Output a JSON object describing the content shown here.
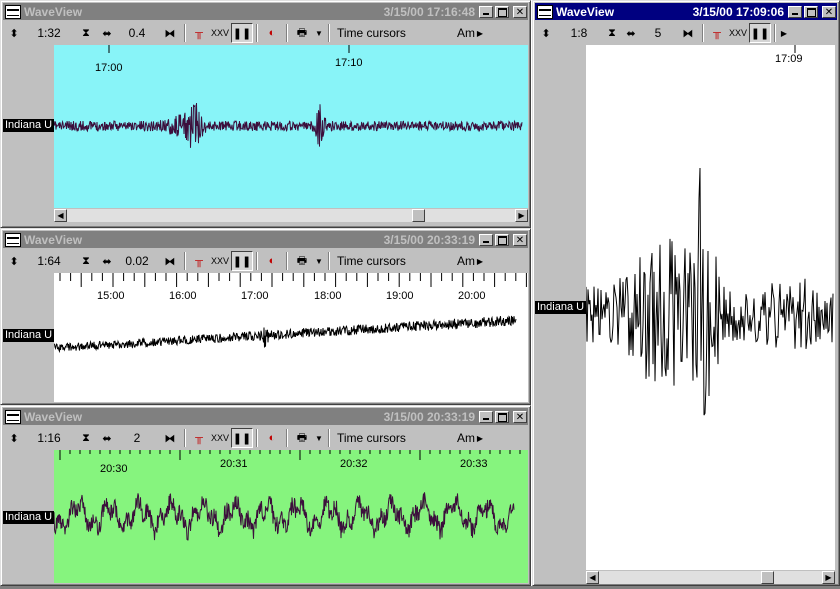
{
  "windows": [
    {
      "title": "WaveView",
      "datetime": "3/15/00 17:16:48",
      "scale": "1:32",
      "gain": "0.4",
      "cursor_mode": "Time cursors",
      "amp_label": "Am",
      "station": "Indiana U",
      "bg_color": "#88f4f8",
      "wave_color": "#3c0f3c",
      "ticks": [
        "17:00",
        "17:10"
      ],
      "active": false
    },
    {
      "title": "WaveView",
      "datetime": "3/15/00 20:33:19",
      "scale": "1:64",
      "gain": "0.02",
      "cursor_mode": "Time cursors",
      "amp_label": "Am",
      "station": "Indiana U",
      "bg_color": "#ffffff",
      "wave_color": "#000000",
      "ticks": [
        "15:00",
        "16:00",
        "17:00",
        "18:00",
        "19:00",
        "20:00"
      ],
      "active": false
    },
    {
      "title": "WaveView",
      "datetime": "3/15/00 20:33:19",
      "scale": "1:16",
      "gain": "2",
      "cursor_mode": "Time cursors",
      "amp_label": "Am",
      "station": "Indiana U",
      "bg_color": "#86f47e",
      "wave_color": "#3c0f3c",
      "ticks": [
        "20:30",
        "20:31",
        "20:32",
        "20:33"
      ],
      "active": false
    },
    {
      "title": "WaveView",
      "datetime": "3/15/00 17:09:06",
      "scale": "1:8",
      "gain": "5",
      "station": "Indiana U",
      "bg_color": "#ffffff",
      "wave_color": "#000000",
      "ticks": [
        "17:09"
      ],
      "active": true
    }
  ]
}
